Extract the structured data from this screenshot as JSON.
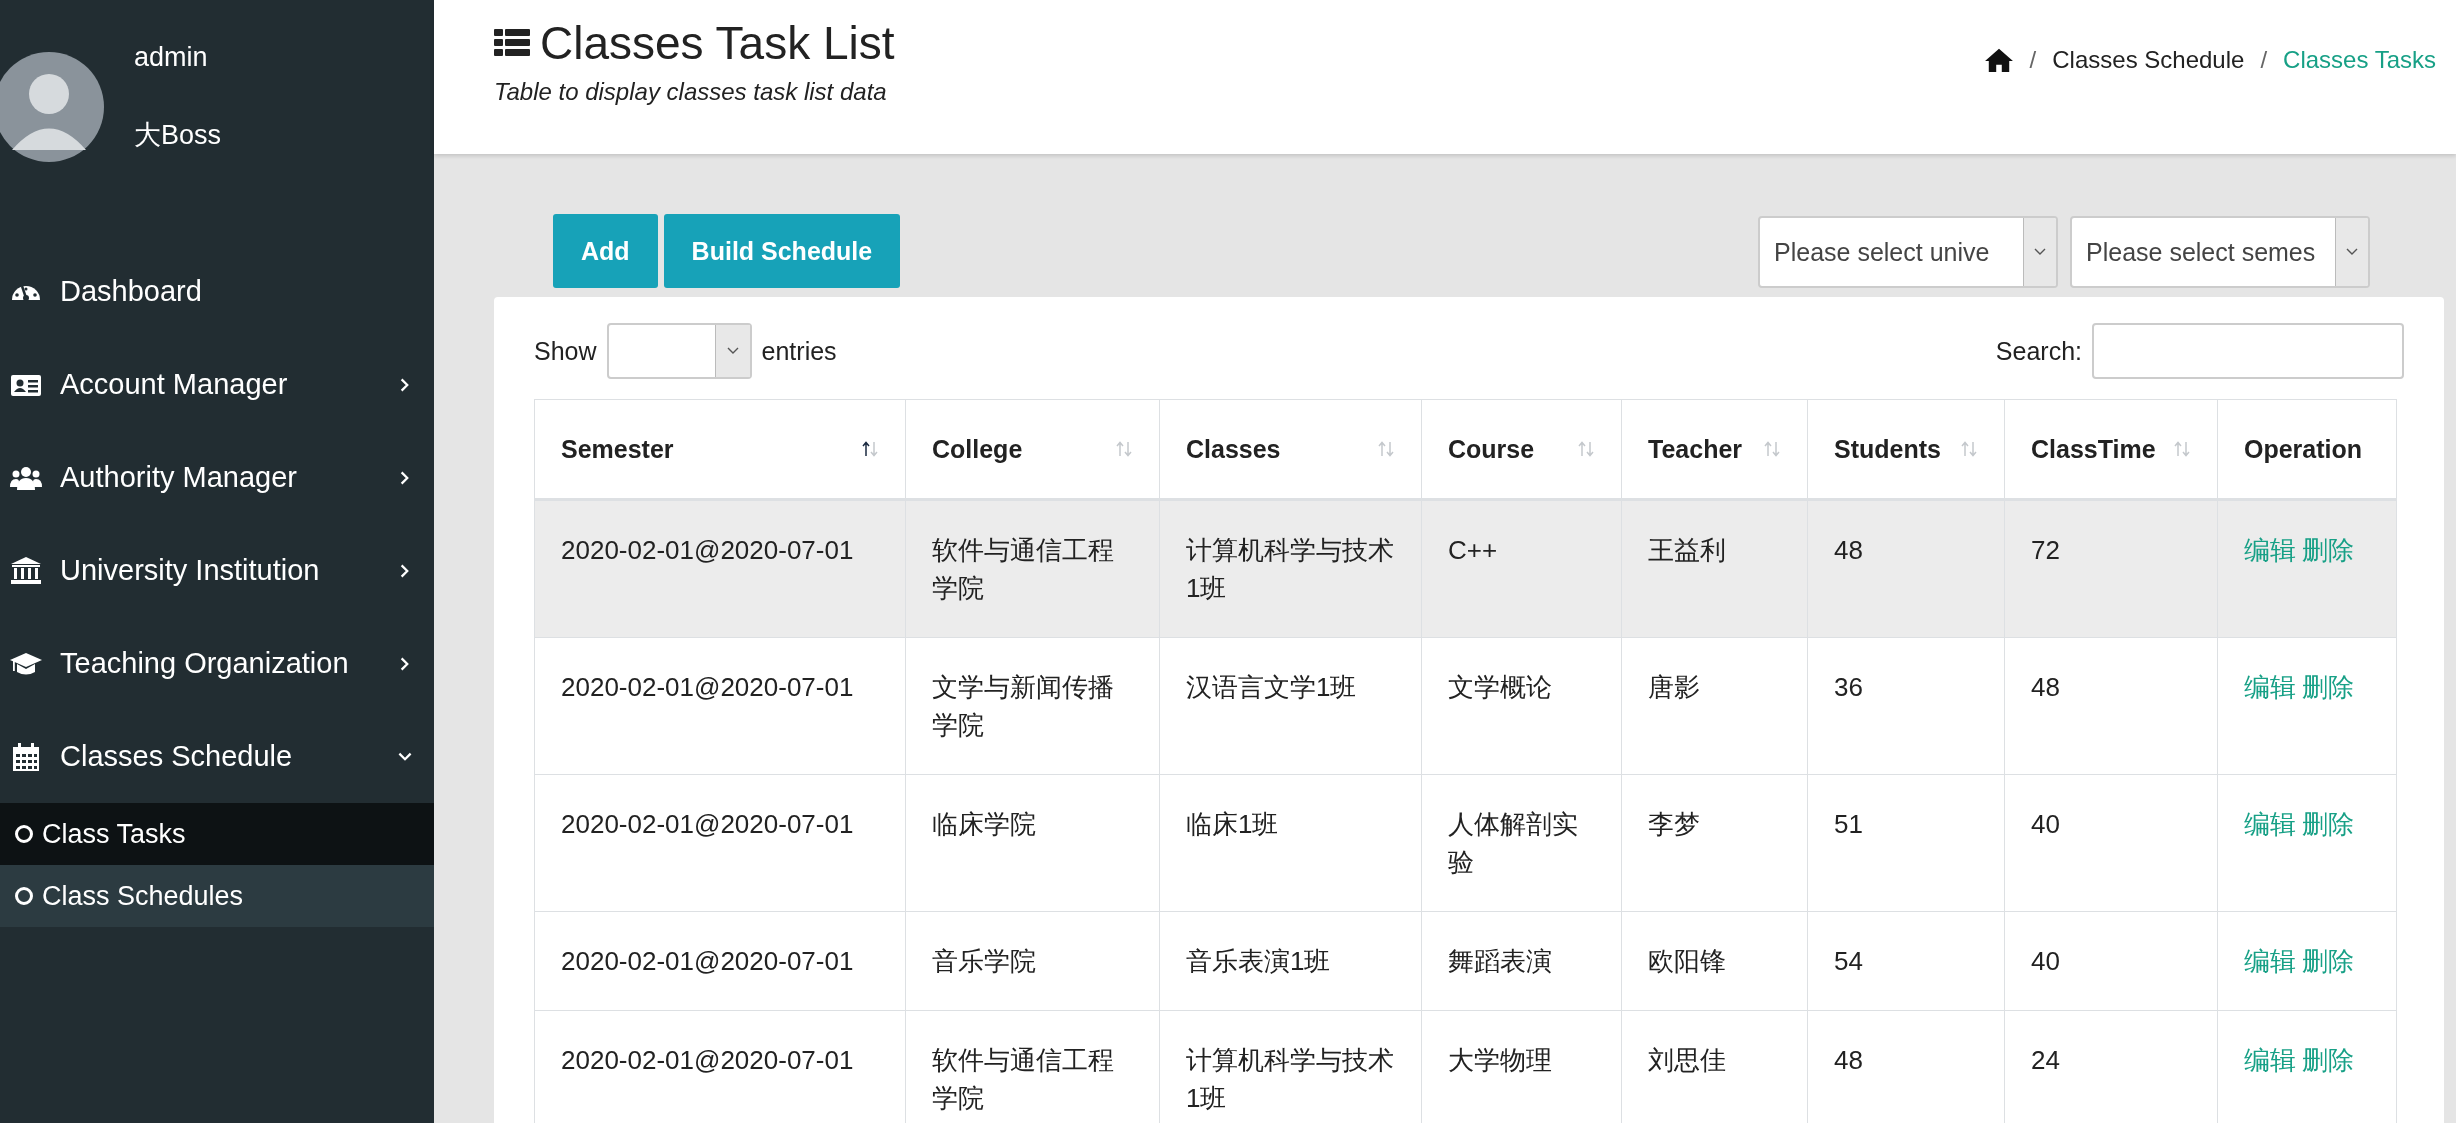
{
  "user": {
    "name": "admin",
    "role": "大Boss"
  },
  "menu": [
    {
      "label": "Dashboard"
    },
    {
      "label": "Account Manager",
      "expanded": false
    },
    {
      "label": "Authority Manager",
      "expanded": false
    },
    {
      "label": "University Institution",
      "expanded": false
    },
    {
      "label": "Teaching Organization",
      "expanded": false
    },
    {
      "label": "Classes Schedule",
      "expanded": true,
      "children": [
        {
          "label": "Class Tasks",
          "selected": true
        },
        {
          "label": "Class Schedules",
          "selected": false
        }
      ]
    }
  ],
  "header": {
    "title": "Classes Task List",
    "subtitle": "Table to display classes task list data",
    "breadcrumb": [
      {
        "kind": "home"
      },
      {
        "kind": "separator",
        "text": "/"
      },
      {
        "kind": "link",
        "text": "Classes Schedule"
      },
      {
        "kind": "separator",
        "text": "/"
      },
      {
        "kind": "current",
        "text": "Classes Tasks"
      }
    ]
  },
  "toolbar": {
    "buttons": [
      "Add",
      "Build Schedule"
    ],
    "selects": [
      "Please select unive",
      "Please select semes"
    ]
  },
  "table_controls": {
    "show_label": "Show",
    "entries_label": "entries",
    "search_label": "Search:"
  },
  "table": {
    "columns": [
      {
        "label": "Semester",
        "sorted": true
      },
      {
        "label": "College",
        "sorted": false
      },
      {
        "label": "Classes",
        "sorted": false
      },
      {
        "label": "Course",
        "sorted": false
      },
      {
        "label": "Teacher",
        "sorted": false
      },
      {
        "label": "Students",
        "sorted": false
      },
      {
        "label": "ClassTime",
        "sorted": false
      },
      {
        "label": "Operation"
      }
    ],
    "rows": [
      {
        "highlighted": true,
        "cells": [
          "2020-02-01@2020-07-01",
          "软件与通信工程学院",
          "计算机科学与技术1班",
          "C++",
          "王益利",
          "48",
          "72"
        ],
        "actions": [
          "编辑",
          "删除"
        ]
      },
      {
        "highlighted": false,
        "cells": [
          "2020-02-01@2020-07-01",
          "文学与新闻传播学院",
          "汉语言文学1班",
          "文学概论",
          "唐影",
          "36",
          "48"
        ],
        "actions": [
          "编辑",
          "删除"
        ]
      },
      {
        "highlighted": false,
        "cells": [
          "2020-02-01@2020-07-01",
          "临床学院",
          "临床1班",
          "人体解剖实验",
          "李梦",
          "51",
          "40"
        ],
        "actions": [
          "编辑",
          "删除"
        ]
      },
      {
        "highlighted": false,
        "cells": [
          "2020-02-01@2020-07-01",
          "音乐学院",
          "音乐表演1班",
          "舞蹈表演",
          "欧阳锋",
          "54",
          "40"
        ],
        "actions": [
          "编辑",
          "删除"
        ]
      },
      {
        "highlighted": false,
        "cells": [
          "2020-02-01@2020-07-01",
          "软件与通信工程学院",
          "计算机科学与技术1班",
          "大学物理",
          "刘思佳",
          "48",
          "24"
        ],
        "actions": [
          "编辑",
          "删除"
        ]
      }
    ]
  }
}
